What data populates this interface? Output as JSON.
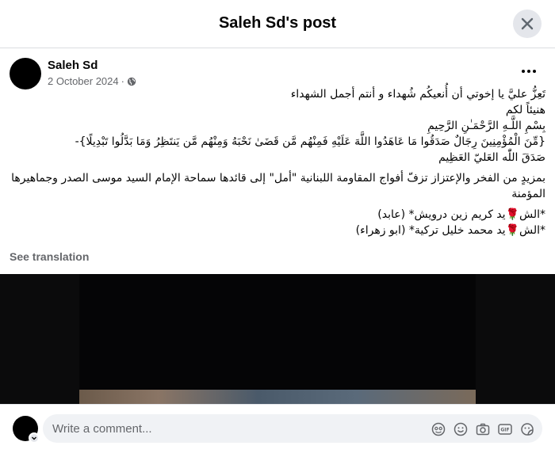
{
  "dialog": {
    "title": "Saleh Sd's post"
  },
  "post": {
    "author": "Saleh Sd",
    "date": "2 October 2024",
    "separator": "·",
    "lines": [
      "تَعِزُّ عليَّ يا إخوتي أن أُنعيكُم شُهداء و أنتم أجمل الشهداء",
      "هنيئاً لكم",
      "بِسْمِ اللَّـهِ الرَّحْمَـٰنِ الرَّحِيمِ",
      "{مِّنَ الْمُؤْمِنِينَ رِجَالٌ صَدَقُوا مَا عَاهَدُوا اللَّهَ عَلَيْهِ فَمِنْهُم مَّن قَضَىٰ نَحْبَهُ وَمِنْهُم مَّن يَنتَظِرُ وَمَا بَدَّلُوا تَبْدِيلًا}-",
      "صَدَقَ اللّٰه العَليّ العَظِيم"
    ],
    "paragraph": "بمزيدٍ من الفخر والإعتزاز تزفّ أفواج المقاومة اللبنانية \"أمل\" إلى قائدها سماحة الإمام السيد موسى الصدر وجماهيرها المؤمنة",
    "martyrs": [
      "*الش🌹يد كريم زين درويش* (عابد)",
      "*الش🌹يد محمد خليل تركية* (ابو زهراء)"
    ],
    "see_translation": "See translation"
  },
  "comment": {
    "placeholder": "Write a comment..."
  },
  "icons": {
    "close": "close-icon",
    "more": "more-horizontal-icon",
    "globe": "globe-icon",
    "avatar_sticker": "avatar-sticker-icon",
    "emoji": "emoji-icon",
    "camera": "camera-icon",
    "gif": "gif-icon",
    "sticker": "sticker-icon"
  },
  "colors": {
    "secondary_text": "#65676b",
    "button_bg": "#e4e6eb",
    "input_bg": "#f0f2f5"
  }
}
